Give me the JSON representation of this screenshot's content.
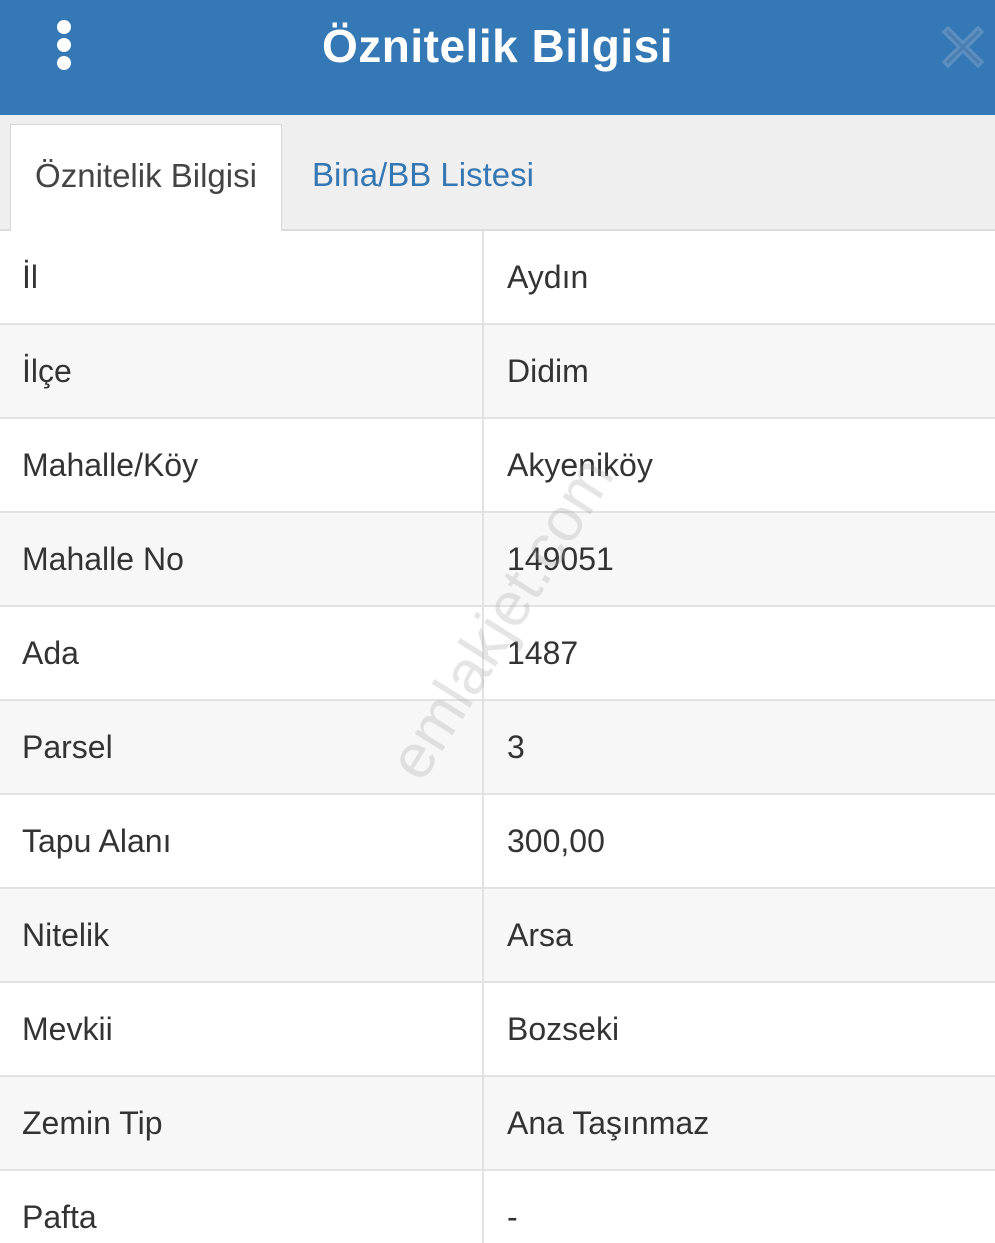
{
  "header": {
    "title": "Öznitelik Bilgisi",
    "menu_icon": "vertical-dots-icon",
    "close_icon": "close-icon",
    "background_color": "#3478b5"
  },
  "tabs": [
    {
      "label": "Öznitelik Bilgisi",
      "active": true
    },
    {
      "label": "Bina/BB Listesi",
      "active": false
    }
  ],
  "attributes": [
    {
      "label": "İl",
      "value": "Aydın"
    },
    {
      "label": "İlçe",
      "value": "Didim"
    },
    {
      "label": "Mahalle/Köy",
      "value": "Akyeniköy"
    },
    {
      "label": "Mahalle No",
      "value": "149051"
    },
    {
      "label": "Ada",
      "value": "1487"
    },
    {
      "label": "Parsel",
      "value": "3"
    },
    {
      "label": "Tapu Alanı",
      "value": "300,00"
    },
    {
      "label": "Nitelik",
      "value": "Arsa"
    },
    {
      "label": "Mevkii",
      "value": "Bozseki"
    },
    {
      "label": "Zemin Tip",
      "value": "Ana Taşınmaz"
    },
    {
      "label": "Pafta",
      "value": "-"
    }
  ],
  "watermark": "emlakjet.com"
}
